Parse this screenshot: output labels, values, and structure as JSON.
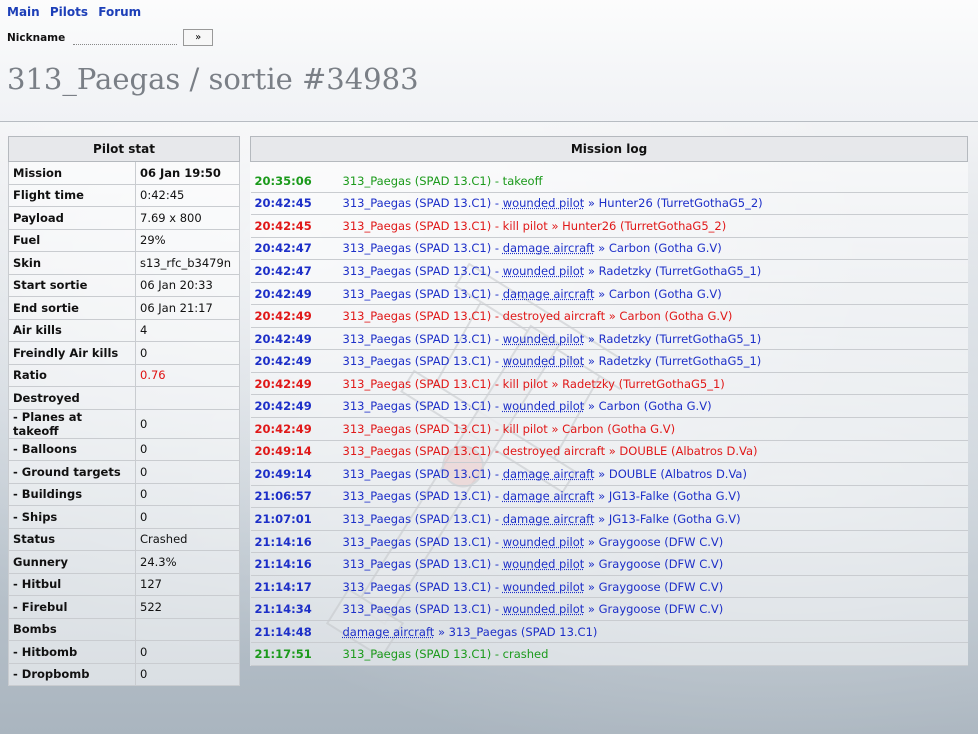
{
  "nav": {
    "main": "Main",
    "pilots": "Pilots",
    "forum": "Forum"
  },
  "nickname": {
    "label": "Nickname",
    "value": "",
    "button": "»"
  },
  "title": "313_Paegas / sortie #34983",
  "stat": {
    "header": "Pilot stat",
    "rows": [
      {
        "k": "Mission",
        "v": "06 Jan 19:50",
        "bold": true
      },
      {
        "k": "Flight time",
        "v": "0:42:45"
      },
      {
        "k": "Payload",
        "v": "7.69 x 800"
      },
      {
        "k": "Fuel",
        "v": "29%"
      },
      {
        "k": "Skin",
        "v": "s13_rfc_b3479n"
      },
      {
        "k": "Start sortie",
        "v": "06 Jan 20:33"
      },
      {
        "k": "End sortie",
        "v": "06 Jan 21:17"
      },
      {
        "k": "Air kills",
        "v": "4"
      },
      {
        "k": "Freindly Air kills",
        "v": "0"
      },
      {
        "k": "Ratio",
        "v": "0.76",
        "red": true
      },
      {
        "k": "Destroyed",
        "v": ""
      },
      {
        "k": "- Planes at takeoff",
        "v": "0"
      },
      {
        "k": "- Balloons",
        "v": "0"
      },
      {
        "k": "- Ground targets",
        "v": "0"
      },
      {
        "k": "- Buildings",
        "v": "0"
      },
      {
        "k": "- Ships",
        "v": "0"
      },
      {
        "k": "Status",
        "v": "Crashed"
      },
      {
        "k": "Gunnery",
        "v": "24.3%"
      },
      {
        "k": "- Hitbul",
        "v": "127"
      },
      {
        "k": "- Firebul",
        "v": "522"
      },
      {
        "k": "Bombs",
        "v": ""
      },
      {
        "k": "- Hitbomb",
        "v": "0"
      },
      {
        "k": "- Dropbomb",
        "v": "0"
      }
    ]
  },
  "log": {
    "header": "Mission log",
    "colors": {
      "green": "#1b9a1b",
      "blue": "#1d2fc8",
      "red": "#e01818"
    },
    "rows": [
      {
        "t": "20:35:06",
        "c": "green",
        "pre": "313_Paegas (SPAD 13.C1) - takeoff",
        "act": "",
        "post": ""
      },
      {
        "t": "20:42:45",
        "c": "blue",
        "pre": "313_Paegas (SPAD 13.C1) - ",
        "act": "wounded pilot",
        "post": " » Hunter26 (TurretGothaG5_2)"
      },
      {
        "t": "20:42:45",
        "c": "red",
        "pre": "313_Paegas (SPAD 13.C1) - kill pilot » Hunter26 (TurretGothaG5_2)",
        "act": "",
        "post": ""
      },
      {
        "t": "20:42:47",
        "c": "blue",
        "pre": "313_Paegas (SPAD 13.C1) - ",
        "act": "damage aircraft",
        "post": " » Carbon (Gotha G.V)"
      },
      {
        "t": "20:42:47",
        "c": "blue",
        "pre": "313_Paegas (SPAD 13.C1) - ",
        "act": "wounded pilot",
        "post": " » Radetzky (TurretGothaG5_1)"
      },
      {
        "t": "20:42:49",
        "c": "blue",
        "pre": "313_Paegas (SPAD 13.C1) - ",
        "act": "damage aircraft",
        "post": " » Carbon (Gotha G.V)"
      },
      {
        "t": "20:42:49",
        "c": "red",
        "pre": "313_Paegas (SPAD 13.C1) - destroyed aircraft » Carbon (Gotha G.V)",
        "act": "",
        "post": ""
      },
      {
        "t": "20:42:49",
        "c": "blue",
        "pre": "313_Paegas (SPAD 13.C1) - ",
        "act": "wounded pilot",
        "post": " » Radetzky (TurretGothaG5_1)"
      },
      {
        "t": "20:42:49",
        "c": "blue",
        "pre": "313_Paegas (SPAD 13.C1) - ",
        "act": "wounded pilot",
        "post": " » Radetzky (TurretGothaG5_1)"
      },
      {
        "t": "20:42:49",
        "c": "red",
        "pre": "313_Paegas (SPAD 13.C1) - kill pilot » Radetzky (TurretGothaG5_1)",
        "act": "",
        "post": ""
      },
      {
        "t": "20:42:49",
        "c": "blue",
        "pre": "313_Paegas (SPAD 13.C1) - ",
        "act": "wounded pilot",
        "post": " » Carbon (Gotha G.V)"
      },
      {
        "t": "20:42:49",
        "c": "red",
        "pre": "313_Paegas (SPAD 13.C1) - kill pilot » Carbon (Gotha G.V)",
        "act": "",
        "post": ""
      },
      {
        "t": "20:49:14",
        "c": "red",
        "pre": "313_Paegas (SPAD 13.C1) - destroyed aircraft » DOUBLE (Albatros D.Va)",
        "act": "",
        "post": ""
      },
      {
        "t": "20:49:14",
        "c": "blue",
        "pre": "313_Paegas (SPAD 13.C1) - ",
        "act": "damage aircraft",
        "post": " » DOUBLE (Albatros D.Va)"
      },
      {
        "t": "21:06:57",
        "c": "blue",
        "pre": "313_Paegas (SPAD 13.C1) - ",
        "act": "damage aircraft",
        "post": " » JG13-Falke (Gotha G.V)"
      },
      {
        "t": "21:07:01",
        "c": "blue",
        "pre": "313_Paegas (SPAD 13.C1) - ",
        "act": "damage aircraft",
        "post": " » JG13-Falke (Gotha G.V)"
      },
      {
        "t": "21:14:16",
        "c": "blue",
        "pre": "313_Paegas (SPAD 13.C1) - ",
        "act": "wounded pilot",
        "post": " » Graygoose (DFW C.V)"
      },
      {
        "t": "21:14:16",
        "c": "blue",
        "pre": "313_Paegas (SPAD 13.C1) - ",
        "act": "wounded pilot",
        "post": " » Graygoose (DFW C.V)"
      },
      {
        "t": "21:14:17",
        "c": "blue",
        "pre": "313_Paegas (SPAD 13.C1) - ",
        "act": "wounded pilot",
        "post": " » Graygoose (DFW C.V)"
      },
      {
        "t": "21:14:34",
        "c": "blue",
        "pre": "313_Paegas (SPAD 13.C1) - ",
        "act": "wounded pilot",
        "post": " » Graygoose (DFW C.V)"
      },
      {
        "t": "21:14:48",
        "c": "blue",
        "pre": "",
        "act": "damage aircraft",
        "post": " » 313_Paegas (SPAD 13.C1)"
      },
      {
        "t": "21:17:51",
        "c": "green",
        "pre": "313_Paegas (SPAD 13.C1) - crashed",
        "act": "",
        "post": ""
      }
    ]
  }
}
